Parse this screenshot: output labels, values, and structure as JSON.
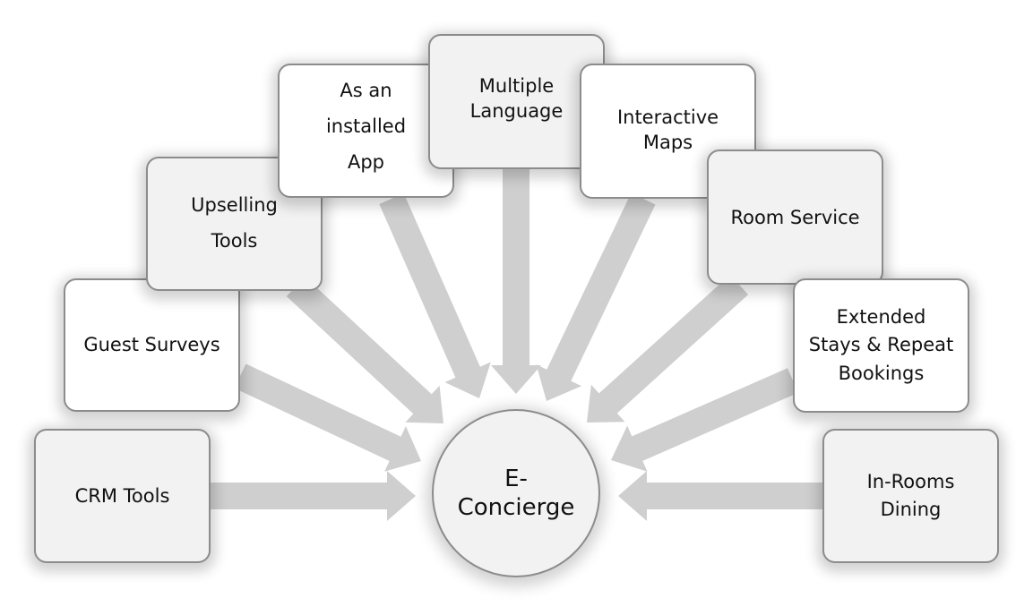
{
  "diagram": {
    "type": "radial-convergence",
    "hub": {
      "label": "E-\nConcierge"
    },
    "arrow_color": "#cfcfcf",
    "nodes": [
      {
        "id": "crm-tools",
        "label": "CRM Tools",
        "style": "grey"
      },
      {
        "id": "guest-surveys",
        "label": "Guest Surveys",
        "style": "white"
      },
      {
        "id": "upselling-tools",
        "label": "Upselling\nTools",
        "style": "grey"
      },
      {
        "id": "installed-app",
        "label": "As an\ninstalled\nApp",
        "style": "white"
      },
      {
        "id": "multiple-language",
        "label": "Multiple\nLanguage",
        "style": "grey"
      },
      {
        "id": "interactive-maps",
        "label": "Interactive\nMaps",
        "style": "white"
      },
      {
        "id": "room-service",
        "label": "Room Service",
        "style": "grey"
      },
      {
        "id": "extended-stays",
        "label": "Extended\nStays & Repeat\nBookings",
        "style": "white"
      },
      {
        "id": "in-rooms-dining",
        "label": "In-Rooms\nDining",
        "style": "grey"
      }
    ]
  }
}
